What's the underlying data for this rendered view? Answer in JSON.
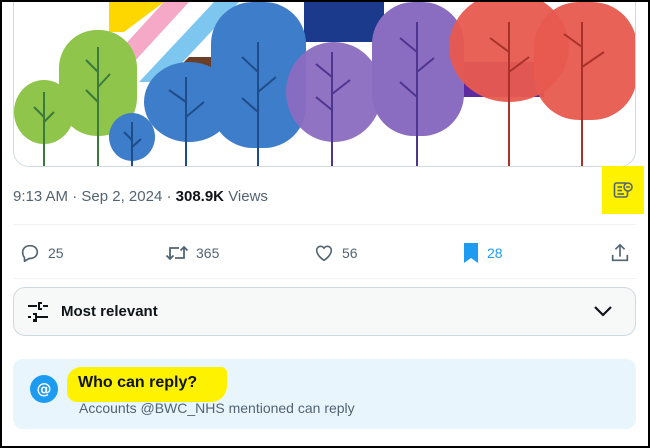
{
  "tweet": {
    "time": "9:13 AM",
    "date": "Sep 2, 2024",
    "views_count": "308.9K",
    "views_label": "Views"
  },
  "actions": {
    "replies": "25",
    "retweets": "365",
    "likes": "56",
    "bookmarks": "28"
  },
  "sort": {
    "label": "Most relevant"
  },
  "who_can_reply": {
    "icon_text": "@",
    "title": "Who can reply?",
    "description": "Accounts @BWC_NHS mentioned can reply"
  },
  "colors": {
    "accent": "#1d9bf0",
    "highlight": "#fff200",
    "muted_text": "#536471",
    "reply_box_bg": "#e8f5fd"
  },
  "icons": [
    "reply-icon",
    "retweet-icon",
    "like-icon",
    "bookmark-icon",
    "share-icon",
    "tune-icon",
    "chevron-down-icon",
    "at-icon",
    "grok-analyze-icon"
  ]
}
